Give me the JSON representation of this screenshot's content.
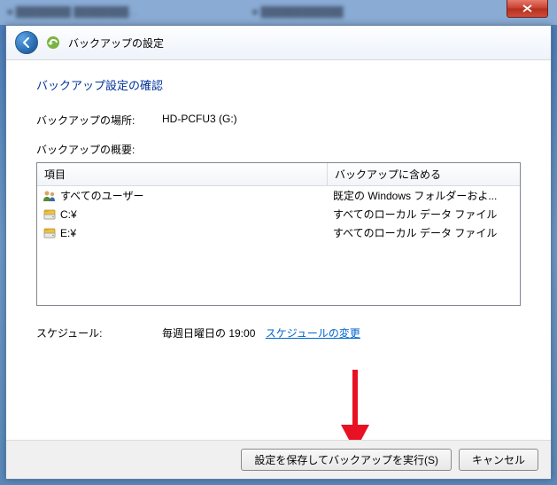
{
  "header_title": "バックアップの設定",
  "page_title": "バックアップ設定の確認",
  "location_label": "バックアップの場所:",
  "location_value": "HD-PCFU3 (G:)",
  "summary_label": "バックアップの概要:",
  "columns": {
    "item": "項目",
    "include": "バックアップに含める"
  },
  "rows": [
    {
      "icon": "users",
      "item": "すべてのユーザー",
      "include": "既定の Windows フォルダーおよ..."
    },
    {
      "icon": "drive",
      "item": "C:¥",
      "include": "すべてのローカル データ ファイル"
    },
    {
      "icon": "drive",
      "item": "E:¥",
      "include": "すべてのローカル データ ファイル"
    }
  ],
  "schedule_label": "スケジュール:",
  "schedule_value": "毎週日曜日の 19:00",
  "schedule_link": "スケジュールの変更",
  "buttons": {
    "run": "設定を保存してバックアップを実行(S)",
    "cancel": "キャンセル"
  }
}
